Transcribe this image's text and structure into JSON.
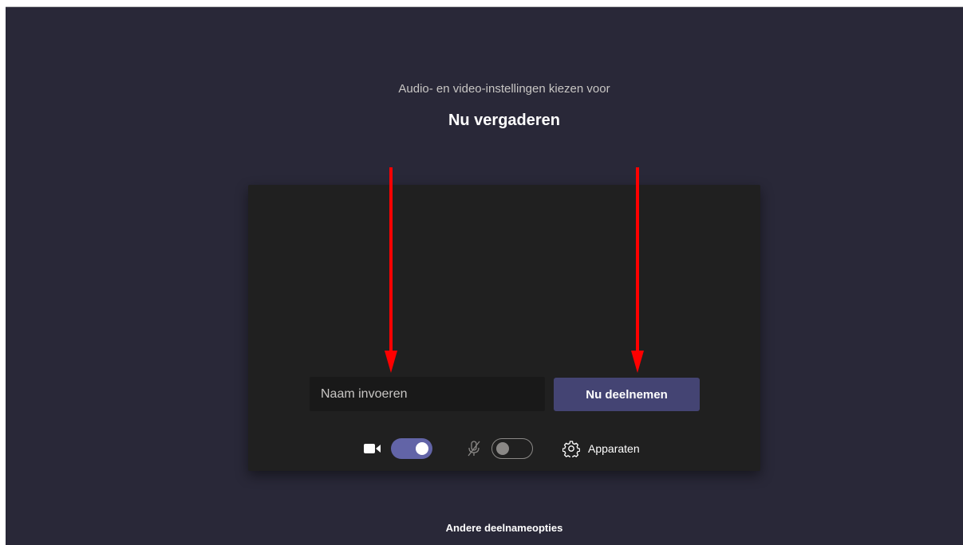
{
  "header": {
    "subtitle": "Audio- en video-instellingen kiezen voor",
    "title": "Nu vergaderen"
  },
  "join_form": {
    "name_placeholder": "Naam invoeren",
    "name_value": "",
    "join_button_label": "Nu deelnemen"
  },
  "controls": {
    "camera": {
      "icon": "video-camera-icon",
      "enabled": true
    },
    "microphone": {
      "icon": "mic-off-icon",
      "enabled": false
    },
    "devices": {
      "icon": "gear-icon",
      "label": "Apparaten"
    }
  },
  "footer": {
    "other_options_label": "Andere deelnameopties"
  },
  "annotations": {
    "arrow_color": "#ff0000"
  },
  "colors": {
    "background": "#292838",
    "preview": "#202020",
    "accent": "#6264a7",
    "join_button": "#444473"
  }
}
